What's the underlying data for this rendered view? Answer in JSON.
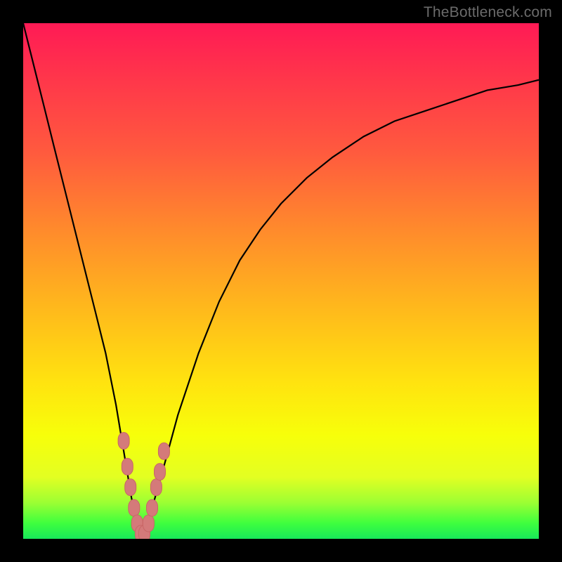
{
  "watermark": "TheBottleneck.com",
  "colors": {
    "frame": "#000000",
    "curve": "#000000",
    "marker_fill": "#d47a7a",
    "marker_stroke": "#c86666",
    "gradient_top": "#ff1a55",
    "gradient_bottom": "#18e85a"
  },
  "chart_data": {
    "type": "line",
    "title": "",
    "xlabel": "",
    "ylabel": "",
    "xlim": [
      0,
      100
    ],
    "ylim": [
      0,
      100
    ],
    "grid": false,
    "legend": false,
    "series": [
      {
        "name": "bottleneck-curve",
        "x": [
          0,
          2,
          4,
          6,
          8,
          10,
          12,
          14,
          16,
          18,
          20,
          21,
          22,
          23,
          24,
          25,
          27,
          30,
          34,
          38,
          42,
          46,
          50,
          55,
          60,
          66,
          72,
          78,
          84,
          90,
          96,
          100
        ],
        "y": [
          100,
          92,
          84,
          76,
          68,
          60,
          52,
          44,
          36,
          26,
          14,
          8,
          3,
          0,
          2,
          6,
          13,
          24,
          36,
          46,
          54,
          60,
          65,
          70,
          74,
          78,
          81,
          83,
          85,
          87,
          88,
          89
        ]
      }
    ],
    "markers": {
      "name": "highlighted-points",
      "shape": "rounded",
      "points": [
        {
          "x": 19.5,
          "y": 19
        },
        {
          "x": 20.2,
          "y": 14
        },
        {
          "x": 20.8,
          "y": 10
        },
        {
          "x": 21.5,
          "y": 6
        },
        {
          "x": 22.1,
          "y": 3
        },
        {
          "x": 22.8,
          "y": 1
        },
        {
          "x": 23.5,
          "y": 1
        },
        {
          "x": 24.3,
          "y": 3
        },
        {
          "x": 25.0,
          "y": 6
        },
        {
          "x": 25.8,
          "y": 10
        },
        {
          "x": 26.5,
          "y": 13
        },
        {
          "x": 27.3,
          "y": 17
        }
      ]
    }
  }
}
